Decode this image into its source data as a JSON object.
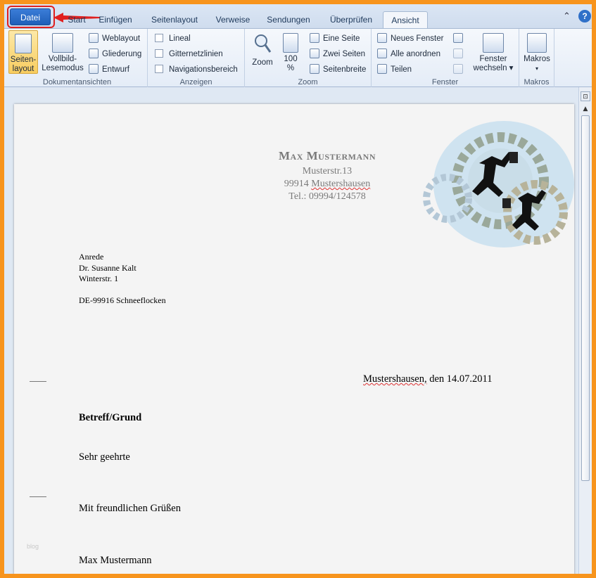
{
  "tabs": {
    "file": "Datei",
    "items": [
      "Start",
      "Einfügen",
      "Seitenlayout",
      "Verweise",
      "Sendungen",
      "Überprüfen",
      "Ansicht"
    ],
    "active": "Ansicht"
  },
  "window": {
    "help": "?",
    "minimize_ribbon": "⌃"
  },
  "ribbon": {
    "groups": {
      "dokumentansichten": "Dokumentansichten",
      "anzeigen": "Anzeigen",
      "zoom": "Zoom",
      "fenster": "Fenster",
      "makros": "Makros"
    },
    "seitenlayout": "Seiten-layout",
    "seitenlayout_l1": "Seiten-",
    "seitenlayout_l2": "layout",
    "vollbild_l1": "Vollbild-",
    "vollbild_l2": "Lesemodus",
    "weblayout": "Weblayout",
    "gliederung": "Gliederung",
    "entwurf": "Entwurf",
    "lineal": "Lineal",
    "gitternetzlinien": "Gitternetzlinien",
    "navigationsbereich": "Navigationsbereich",
    "zoom": "Zoom",
    "zoom100_l1": "100",
    "zoom100_l2": "%",
    "eine_seite": "Eine Seite",
    "zwei_seiten": "Zwei Seiten",
    "seitenbreite": "Seitenbreite",
    "neues_fenster": "Neues Fenster",
    "alle_anordnen": "Alle anordnen",
    "teilen": "Teilen",
    "fenster_wechseln_l1": "Fenster",
    "fenster_wechseln_l2": "wechseln ▾",
    "makros": "Makros",
    "makros_arrow": "▾"
  },
  "document": {
    "sender_name": "Max Mustermann",
    "sender_street": "Musterstr.13",
    "sender_zip": "99914",
    "sender_city": "Mustershausen",
    "sender_phone": "Tel.: 09994/124578",
    "recipient": [
      "Anrede",
      "Dr. Susanne Kalt",
      "Winterstr. 1",
      "",
      "DE-99916 Schneeflocken"
    ],
    "date_place": "Mustershausen,",
    "date_value": "den 14.07.2011",
    "subject": "Betreff/Grund",
    "salutation": "Sehr geehrte",
    "closing": "Mit freundlichen Grüßen",
    "signature": "Max Mustermann",
    "watermark": "blog"
  },
  "colors": {
    "accent": "#2b6cc4",
    "frame": "#f7941d",
    "highlight": "#e0201f"
  }
}
